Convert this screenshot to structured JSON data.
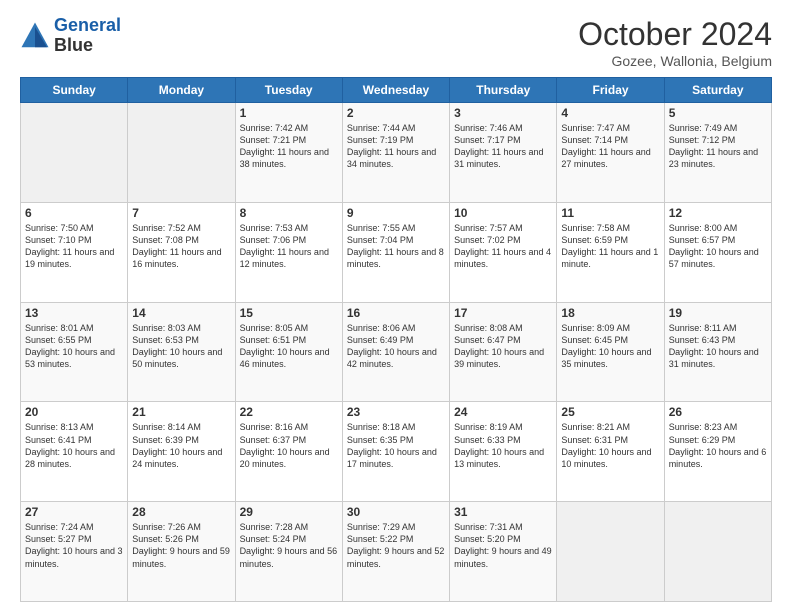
{
  "logo": {
    "line1": "General",
    "line2": "Blue"
  },
  "header": {
    "month": "October 2024",
    "location": "Gozee, Wallonia, Belgium"
  },
  "weekdays": [
    "Sunday",
    "Monday",
    "Tuesday",
    "Wednesday",
    "Thursday",
    "Friday",
    "Saturday"
  ],
  "weeks": [
    [
      {
        "day": "",
        "empty": true
      },
      {
        "day": "",
        "empty": true
      },
      {
        "day": "1",
        "sunrise": "7:42 AM",
        "sunset": "7:21 PM",
        "daylight": "11 hours and 38 minutes."
      },
      {
        "day": "2",
        "sunrise": "7:44 AM",
        "sunset": "7:19 PM",
        "daylight": "11 hours and 34 minutes."
      },
      {
        "day": "3",
        "sunrise": "7:46 AM",
        "sunset": "7:17 PM",
        "daylight": "11 hours and 31 minutes."
      },
      {
        "day": "4",
        "sunrise": "7:47 AM",
        "sunset": "7:14 PM",
        "daylight": "11 hours and 27 minutes."
      },
      {
        "day": "5",
        "sunrise": "7:49 AM",
        "sunset": "7:12 PM",
        "daylight": "11 hours and 23 minutes."
      }
    ],
    [
      {
        "day": "6",
        "sunrise": "7:50 AM",
        "sunset": "7:10 PM",
        "daylight": "11 hours and 19 minutes."
      },
      {
        "day": "7",
        "sunrise": "7:52 AM",
        "sunset": "7:08 PM",
        "daylight": "11 hours and 16 minutes."
      },
      {
        "day": "8",
        "sunrise": "7:53 AM",
        "sunset": "7:06 PM",
        "daylight": "11 hours and 12 minutes."
      },
      {
        "day": "9",
        "sunrise": "7:55 AM",
        "sunset": "7:04 PM",
        "daylight": "11 hours and 8 minutes."
      },
      {
        "day": "10",
        "sunrise": "7:57 AM",
        "sunset": "7:02 PM",
        "daylight": "11 hours and 4 minutes."
      },
      {
        "day": "11",
        "sunrise": "7:58 AM",
        "sunset": "6:59 PM",
        "daylight": "11 hours and 1 minute."
      },
      {
        "day": "12",
        "sunrise": "8:00 AM",
        "sunset": "6:57 PM",
        "daylight": "10 hours and 57 minutes."
      }
    ],
    [
      {
        "day": "13",
        "sunrise": "8:01 AM",
        "sunset": "6:55 PM",
        "daylight": "10 hours and 53 minutes."
      },
      {
        "day": "14",
        "sunrise": "8:03 AM",
        "sunset": "6:53 PM",
        "daylight": "10 hours and 50 minutes."
      },
      {
        "day": "15",
        "sunrise": "8:05 AM",
        "sunset": "6:51 PM",
        "daylight": "10 hours and 46 minutes."
      },
      {
        "day": "16",
        "sunrise": "8:06 AM",
        "sunset": "6:49 PM",
        "daylight": "10 hours and 42 minutes."
      },
      {
        "day": "17",
        "sunrise": "8:08 AM",
        "sunset": "6:47 PM",
        "daylight": "10 hours and 39 minutes."
      },
      {
        "day": "18",
        "sunrise": "8:09 AM",
        "sunset": "6:45 PM",
        "daylight": "10 hours and 35 minutes."
      },
      {
        "day": "19",
        "sunrise": "8:11 AM",
        "sunset": "6:43 PM",
        "daylight": "10 hours and 31 minutes."
      }
    ],
    [
      {
        "day": "20",
        "sunrise": "8:13 AM",
        "sunset": "6:41 PM",
        "daylight": "10 hours and 28 minutes."
      },
      {
        "day": "21",
        "sunrise": "8:14 AM",
        "sunset": "6:39 PM",
        "daylight": "10 hours and 24 minutes."
      },
      {
        "day": "22",
        "sunrise": "8:16 AM",
        "sunset": "6:37 PM",
        "daylight": "10 hours and 20 minutes."
      },
      {
        "day": "23",
        "sunrise": "8:18 AM",
        "sunset": "6:35 PM",
        "daylight": "10 hours and 17 minutes."
      },
      {
        "day": "24",
        "sunrise": "8:19 AM",
        "sunset": "6:33 PM",
        "daylight": "10 hours and 13 minutes."
      },
      {
        "day": "25",
        "sunrise": "8:21 AM",
        "sunset": "6:31 PM",
        "daylight": "10 hours and 10 minutes."
      },
      {
        "day": "26",
        "sunrise": "8:23 AM",
        "sunset": "6:29 PM",
        "daylight": "10 hours and 6 minutes."
      }
    ],
    [
      {
        "day": "27",
        "sunrise": "7:24 AM",
        "sunset": "5:27 PM",
        "daylight": "10 hours and 3 minutes."
      },
      {
        "day": "28",
        "sunrise": "7:26 AM",
        "sunset": "5:26 PM",
        "daylight": "9 hours and 59 minutes."
      },
      {
        "day": "29",
        "sunrise": "7:28 AM",
        "sunset": "5:24 PM",
        "daylight": "9 hours and 56 minutes."
      },
      {
        "day": "30",
        "sunrise": "7:29 AM",
        "sunset": "5:22 PM",
        "daylight": "9 hours and 52 minutes."
      },
      {
        "day": "31",
        "sunrise": "7:31 AM",
        "sunset": "5:20 PM",
        "daylight": "9 hours and 49 minutes."
      },
      {
        "day": "",
        "empty": true
      },
      {
        "day": "",
        "empty": true
      }
    ]
  ]
}
